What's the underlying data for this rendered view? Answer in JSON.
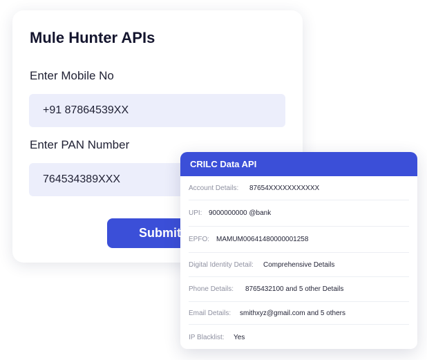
{
  "form": {
    "title": "Mule Hunter APIs",
    "mobile_label": "Enter Mobile No",
    "mobile_value": "+91 87864539XX",
    "pan_label": "Enter PAN Number",
    "pan_value": "764534389XXX",
    "submit_label": "Submit"
  },
  "api_card": {
    "title": "CRILC Data API",
    "rows": [
      {
        "key": "Account Details:",
        "value": "87654XXXXXXXXXXX"
      },
      {
        "key": "UPI:",
        "value": "9000000000 @bank"
      },
      {
        "key": "EPFO:",
        "value": "MAMUM00641480000001258"
      },
      {
        "key": "Digital Identity Detail:",
        "value": "Comprehensive Details"
      },
      {
        "key": "Phone Details:",
        "value": "8765432100 and 5 other Details"
      },
      {
        "key": "Email Details:",
        "value": "smithxyz@gmail.com and 5 others"
      },
      {
        "key": "IP Blacklist:",
        "value": "Yes"
      }
    ]
  },
  "colors": {
    "accent": "#3b4fd8",
    "input_bg": "#eceefb",
    "text_dark": "#14152e",
    "text_muted": "#8e90a0"
  }
}
